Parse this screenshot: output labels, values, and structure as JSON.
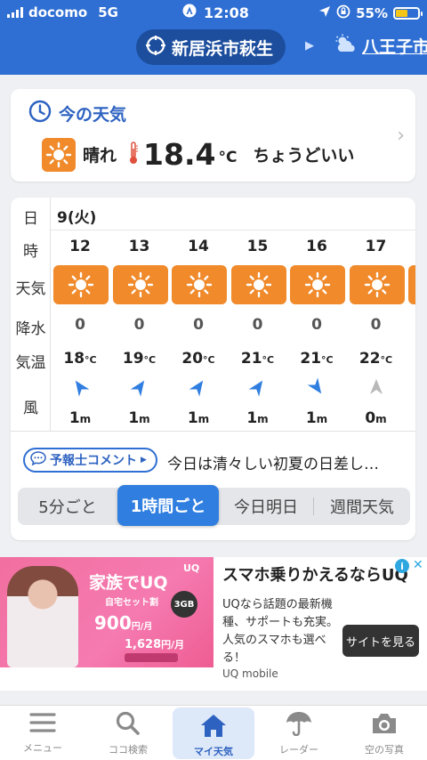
{
  "status_bar": {
    "carrier": "docomo",
    "network": "5G",
    "time": "12:08",
    "battery": "55%",
    "battery_level": 0.55
  },
  "header": {
    "current_location": "新居浜市萩生",
    "next_location": "八王子市"
  },
  "now": {
    "title": "今の天気",
    "condition": "晴れ",
    "temperature": "18.4",
    "unit": "°C",
    "feel": "ちょうどいい"
  },
  "hourly": {
    "labels": {
      "day": "日",
      "hour": "時",
      "weather": "天気",
      "precip": "降水",
      "temp": "気温",
      "wind": "風"
    },
    "date": "9(火)",
    "hours": [
      "12",
      "13",
      "14",
      "15",
      "16",
      "17"
    ],
    "precip": [
      "0",
      "0",
      "0",
      "0",
      "0",
      "0"
    ],
    "temps": [
      "18",
      "19",
      "20",
      "21",
      "21",
      "22"
    ],
    "temp_unit": "°C",
    "wind_speeds": [
      "1",
      "1",
      "1",
      "1",
      "1",
      "0"
    ],
    "wind_unit": "m",
    "wind_directions": [
      "northeast",
      "southeast",
      "southeast",
      "southeast",
      "southwest",
      "calm"
    ]
  },
  "comment": {
    "tag": "予報士コメント",
    "text": "今日は清々しい初夏の日差し…"
  },
  "segments": {
    "five_min": "5分ごと",
    "hourly": "1時間ごと",
    "today_tomorrow": "今日明日",
    "weekly": "週間天気"
  },
  "ad": {
    "brand": "家族でUQ",
    "uq_mark": "UQ",
    "sub": "自宅セット割",
    "price": "900",
    "price_unit": "円/月",
    "data_badge": "3GB",
    "price2": "1,628",
    "price2_unit": "円/月",
    "headline": "スマホ乗りかえるならUQ",
    "description": "UQなら話題の最新機種、サポートも充実。人気のスマホも選べる！",
    "button": "サイトを見る",
    "advertiser": "UQ mobile"
  },
  "tabs": {
    "menu": "メニュー",
    "search": "ココ検索",
    "my_weather": "マイ天気",
    "radar": "レーダー",
    "sky_photo": "空の写真"
  },
  "colors": {
    "header_blue": "#2f6fd3",
    "accent_orange": "#f08a2b",
    "wind_arrow_blue": "#2f7ee0",
    "calm_arrow_grey": "#b8b8b8"
  }
}
